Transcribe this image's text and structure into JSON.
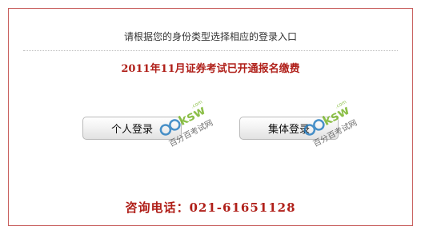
{
  "prompt": "请根据您的身份类型选择相应的登录入口",
  "notice": "2011年11月证券考试已开通报名缴费",
  "buttons": {
    "personal_label": "个人登录",
    "group_label": "集体登录"
  },
  "watermark": {
    "logo_text": "100ksw",
    "domain_suffix": ".com",
    "site_name": "百分百考试网"
  },
  "consult": {
    "label": "咨询电话：",
    "phone": "021-61651128"
  },
  "colors": {
    "frame_border": "#c8605e",
    "accent_red": "#b0201a",
    "watermark_blue": "#2a7fc1",
    "watermark_green": "#79b52a"
  }
}
